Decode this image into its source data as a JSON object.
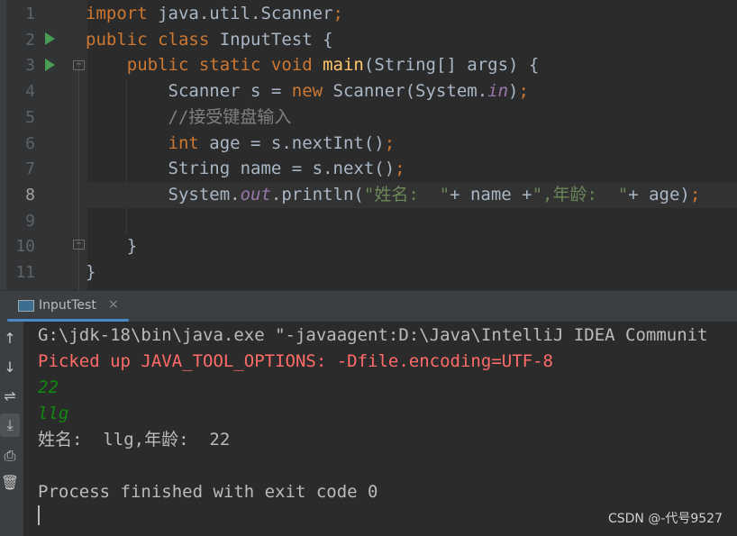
{
  "editor": {
    "line_numbers": [
      "1",
      "2",
      "3",
      "4",
      "5",
      "6",
      "7",
      "8",
      "9",
      "10",
      "11"
    ],
    "current_line": "8",
    "lines": [
      [
        {
          "c": "kw",
          "t": "import "
        },
        {
          "c": "tx",
          "t": "java.util.Scanner"
        },
        {
          "c": "kw",
          "t": ";"
        }
      ],
      [
        {
          "c": "kw",
          "t": "public class "
        },
        {
          "c": "tx",
          "t": "InputTest {"
        }
      ],
      [
        {
          "c": "kw",
          "t": "    public static void "
        },
        {
          "c": "fn",
          "t": "main"
        },
        {
          "c": "tx",
          "t": "(String[] args) {"
        }
      ],
      [
        {
          "c": "tx",
          "t": "        Scanner s = "
        },
        {
          "c": "kw",
          "t": "new "
        },
        {
          "c": "tx",
          "t": "Scanner(System."
        },
        {
          "c": "sf",
          "t": "in"
        },
        {
          "c": "tx",
          "t": ")"
        },
        {
          "c": "kw",
          "t": ";"
        }
      ],
      [
        {
          "c": "cm",
          "t": "        //接受键盘输入"
        }
      ],
      [
        {
          "c": "kw",
          "t": "        int "
        },
        {
          "c": "tx",
          "t": "age = s.nextInt()"
        },
        {
          "c": "kw",
          "t": ";"
        }
      ],
      [
        {
          "c": "tx",
          "t": "        String name = s.next()"
        },
        {
          "c": "kw",
          "t": ";"
        }
      ],
      [
        {
          "c": "tx",
          "t": "        System."
        },
        {
          "c": "sf",
          "t": "out"
        },
        {
          "c": "tx",
          "t": ".println("
        },
        {
          "c": "st",
          "t": "\"姓名:  \""
        },
        {
          "c": "tx",
          "t": "+ name +"
        },
        {
          "c": "st",
          "t": "\",年龄:  \""
        },
        {
          "c": "tx",
          "t": "+ age)"
        },
        {
          "c": "kw",
          "t": ";"
        }
      ],
      [
        {
          "c": "tx",
          "t": ""
        }
      ],
      [
        {
          "c": "tx",
          "t": "    }"
        }
      ],
      [
        {
          "c": "tx",
          "t": "}"
        }
      ]
    ]
  },
  "run_tab": {
    "label": "InputTest",
    "close": "×"
  },
  "toolbar_icons": [
    "arrow-up-icon",
    "arrow-down-icon",
    "soft-wrap-icon",
    "scroll-to-end-icon",
    "print-icon",
    "trash-icon"
  ],
  "console": {
    "lines": [
      {
        "c": "",
        "t": "G:\\jdk-18\\bin\\java.exe \"-javaagent:D:\\Java\\IntelliJ IDEA Communit"
      },
      {
        "c": "red",
        "t": "Picked up JAVA_TOOL_OPTIONS: -Dfile.encoding=UTF-8"
      },
      {
        "c": "grn",
        "t": "22"
      },
      {
        "c": "grn",
        "t": "llg"
      },
      {
        "c": "",
        "t": "姓名:  llg,年龄:  22"
      },
      {
        "c": "",
        "t": ""
      },
      {
        "c": "",
        "t": "Process finished with exit code 0"
      }
    ]
  },
  "watermark": "CSDN @-代号9527",
  "colors": {
    "background": "#2b2b2b",
    "keyword": "#cc7832",
    "string": "#6a8759",
    "error": "#ff6b68",
    "input": "#0f8a0f"
  }
}
